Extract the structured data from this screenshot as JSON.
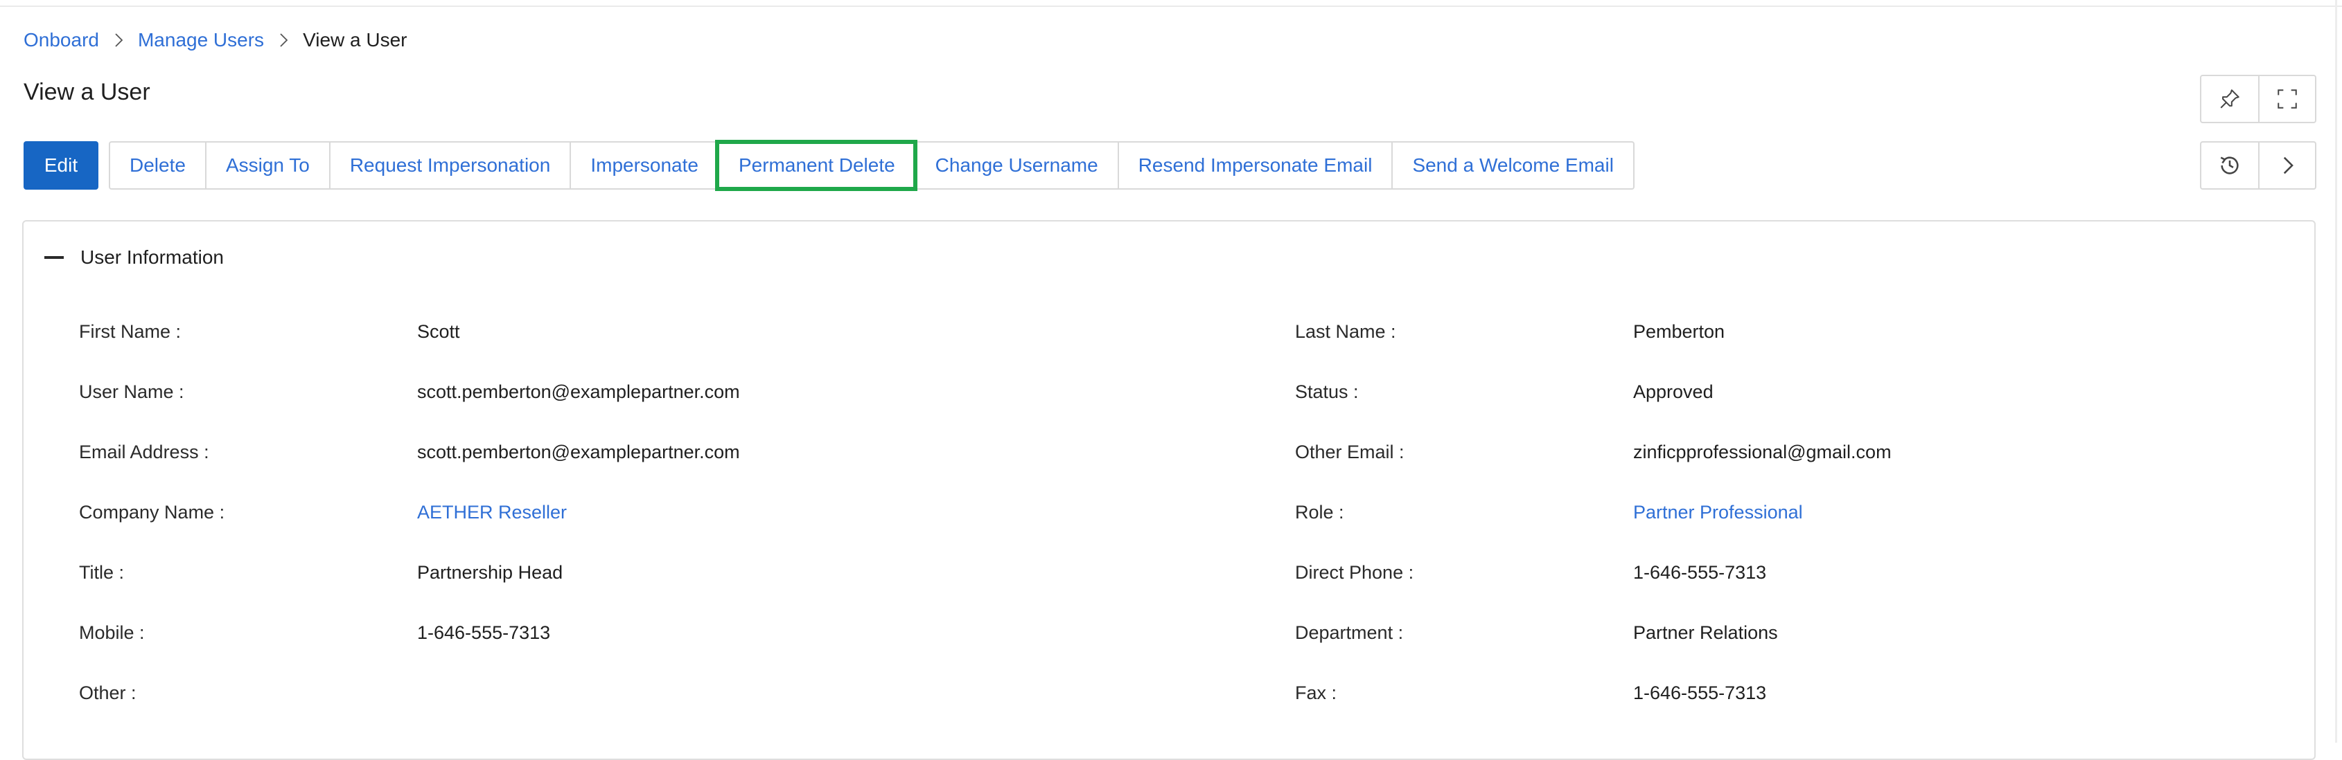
{
  "breadcrumb": {
    "items": [
      "Onboard",
      "Manage Users",
      "View a User"
    ]
  },
  "page": {
    "title": "View a User"
  },
  "toolbar": {
    "edit_label": "Edit",
    "buttons": [
      "Delete",
      "Assign To",
      "Request Impersonation",
      "Impersonate",
      "Permanent Delete",
      "Change Username",
      "Resend Impersonate Email",
      "Send a Welcome Email"
    ],
    "highlighted": "Permanent Delete"
  },
  "icons": {
    "pin": "pin-icon",
    "fullscreen": "fullscreen-icon",
    "history": "history-icon",
    "next": "chevron-right-icon"
  },
  "section": {
    "title": "User Information"
  },
  "fields": {
    "left": [
      {
        "label": "First Name :",
        "value": "Scott"
      },
      {
        "label": "User Name :",
        "value": "scott.pemberton@examplepartner.com"
      },
      {
        "label": "Email Address :",
        "value": "scott.pemberton@examplepartner.com"
      },
      {
        "label": "Company Name :",
        "value": "AETHER Reseller"
      },
      {
        "label": "Title :",
        "value": "Partnership Head"
      },
      {
        "label": "Mobile :",
        "value": "1-646-555-7313"
      },
      {
        "label": "Other :",
        "value": ""
      }
    ],
    "right": [
      {
        "label": "Last Name :",
        "value": "Pemberton"
      },
      {
        "label": "Status :",
        "value": "Approved"
      },
      {
        "label": "Other Email :",
        "value": "zinficpprofessional@gmail.com"
      },
      {
        "label": "Role :",
        "value": "Partner Professional"
      },
      {
        "label": "Direct Phone :",
        "value": "1-646-555-7313"
      },
      {
        "label": "Department :",
        "value": "Partner Relations"
      },
      {
        "label": "Fax :",
        "value": "1-646-555-7313"
      }
    ]
  },
  "colors": {
    "link": "#2f6fd6",
    "primary_button": "#1766c4",
    "highlight_outline": "#1fa84a"
  }
}
